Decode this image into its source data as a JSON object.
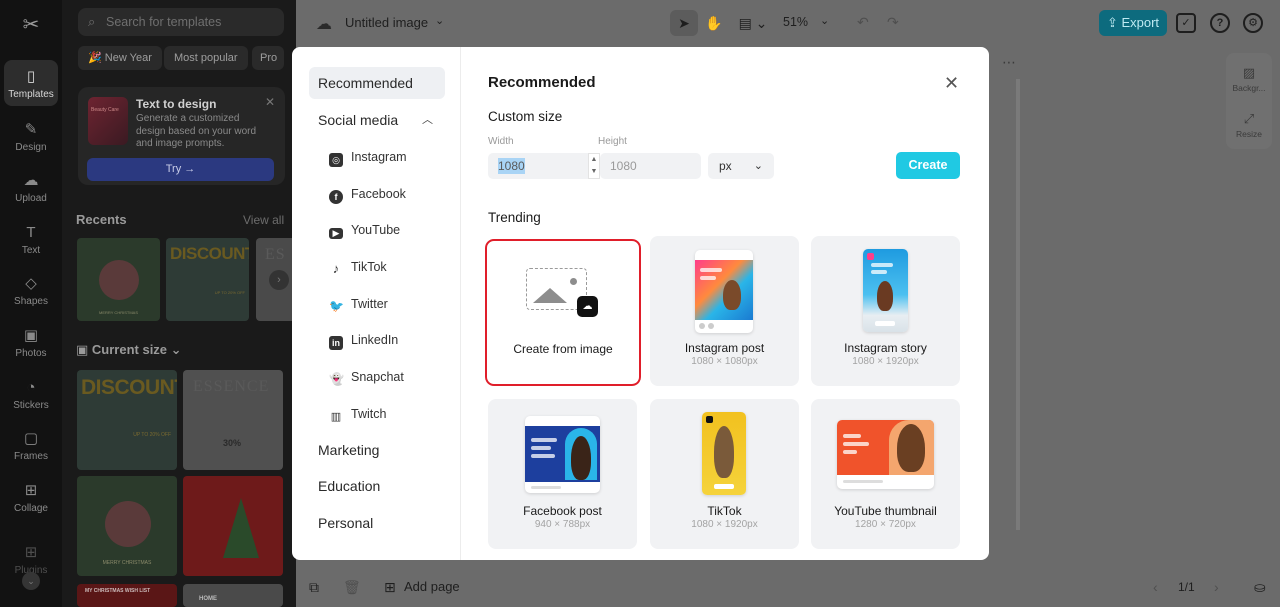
{
  "app": {
    "search_placeholder": "Search for templates",
    "chips": [
      "New Year",
      "Most popular",
      "Pro"
    ],
    "rail": [
      "Templates",
      "Design",
      "Upload",
      "Text",
      "Shapes",
      "Photos",
      "Stickers",
      "Frames",
      "Collage",
      "Plugins"
    ],
    "promo": {
      "title": "Text to design",
      "description": "Generate a customized design based on your word and image prompts.",
      "try_label": "Try →",
      "thumb_text": "Beauty Care"
    },
    "recents_title": "Recents",
    "view_all": "View all",
    "current_size_title": "Current size",
    "thumb_texts": {
      "discount": "DISCOUNT",
      "essence": "ESSENCE",
      "es": "ES",
      "merry": "MERRY CHRISTMAS",
      "upto": "UP TO 20% OFF",
      "thirty": "30%",
      "wishlist": "MY CHRISTMAS WISH LIST",
      "home": "HOME"
    }
  },
  "topbar": {
    "doc_title": "Untitled image",
    "zoom": "51%",
    "export_label": "Export"
  },
  "side_tools": [
    "Backgr...",
    "Resize"
  ],
  "bottombar": {
    "add_page": "Add page",
    "pages": "1/1"
  },
  "modal": {
    "title": "Recommended",
    "categories": {
      "recommended": "Recommended",
      "social_media": "Social media",
      "marketing": "Marketing",
      "education": "Education",
      "personal": "Personal"
    },
    "social_items": [
      "Instagram",
      "Facebook",
      "YouTube",
      "TikTok",
      "Twitter",
      "LinkedIn",
      "Snapchat",
      "Twitch"
    ],
    "custom_size": {
      "title": "Custom size",
      "width_label": "Width",
      "height_label": "Height",
      "width_value": "1080",
      "height_value": "1080",
      "unit": "px",
      "create_label": "Create"
    },
    "trending_title": "Trending",
    "cards": [
      {
        "label": "Create from image",
        "dim": ""
      },
      {
        "label": "Instagram post",
        "dim": "1080 × 1080px"
      },
      {
        "label": "Instagram story",
        "dim": "1080 × 1920px"
      },
      {
        "label": "Facebook post",
        "dim": "940 × 788px"
      },
      {
        "label": "TikTok",
        "dim": "1080 × 1920px"
      },
      {
        "label": "YouTube thumbnail",
        "dim": "1280 × 720px"
      }
    ]
  },
  "colors": {
    "accent": "#20c9e3",
    "selected_border": "#e01e2a",
    "export_bg": "#0d6b7e"
  }
}
